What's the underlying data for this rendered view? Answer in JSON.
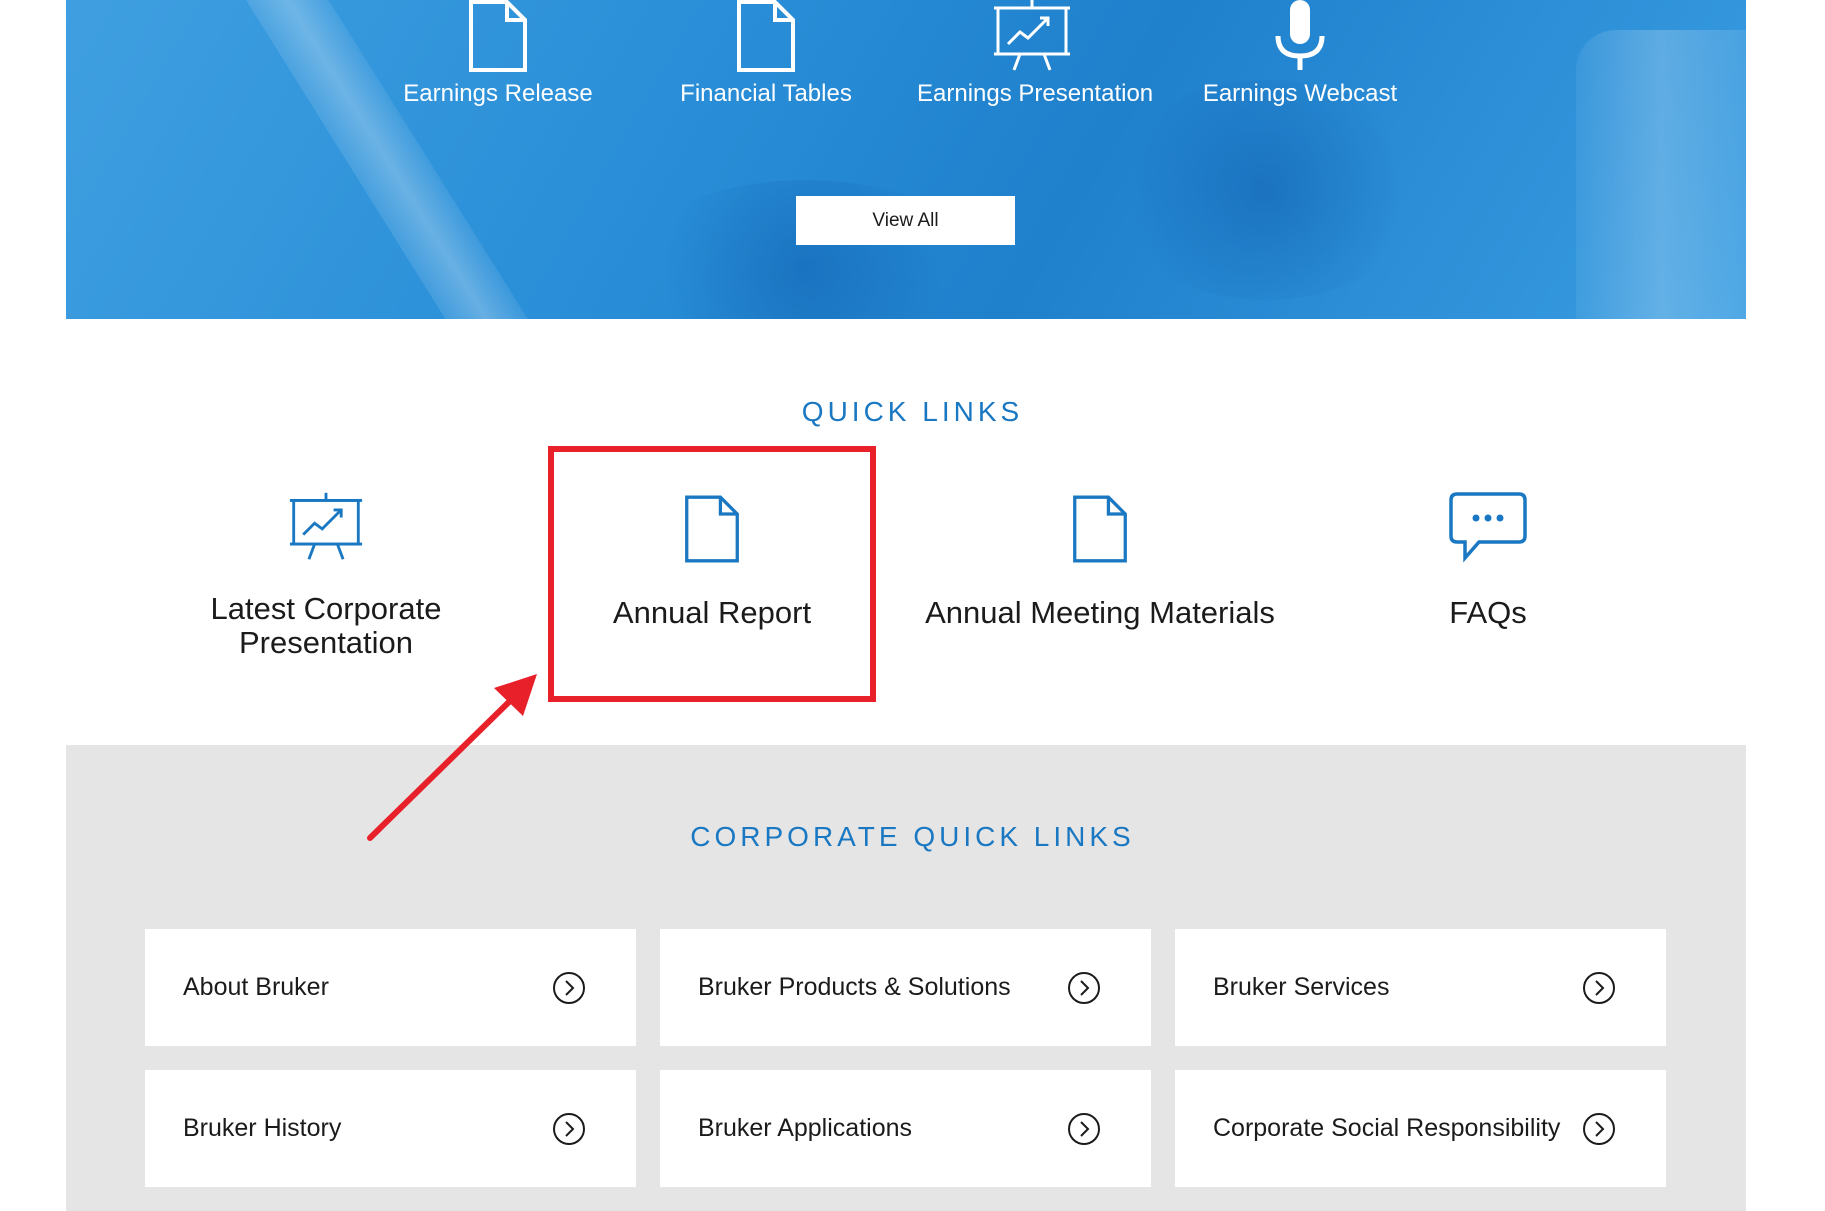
{
  "hero": {
    "items": [
      {
        "label": "Earnings Release",
        "icon": "document-icon"
      },
      {
        "label": "Financial Tables",
        "icon": "document-icon"
      },
      {
        "label": "Earnings Presentation",
        "icon": "presentation-board-icon"
      },
      {
        "label": "Earnings Webcast",
        "icon": "microphone-icon"
      }
    ],
    "view_all_label": "View All"
  },
  "quick_links": {
    "title": "QUICK LINKS",
    "items": [
      {
        "label": "Latest Corporate Presentation",
        "icon": "presentation-board-icon"
      },
      {
        "label": "Annual Report",
        "icon": "document-icon"
      },
      {
        "label": "Annual Meeting Materials",
        "icon": "document-icon"
      },
      {
        "label": "FAQs",
        "icon": "chat-bubble-icon"
      }
    ]
  },
  "corporate_quick_links": {
    "title": "CORPORATE QUICK LINKS",
    "items": [
      {
        "label": "About Bruker"
      },
      {
        "label": "Bruker Products & Solutions"
      },
      {
        "label": "Bruker Services"
      },
      {
        "label": "Bruker History"
      },
      {
        "label": "Bruker Applications"
      },
      {
        "label": "Corporate Social Responsibility"
      }
    ]
  },
  "colors": {
    "accent_blue": "#1a78c2",
    "hero_blue": "#2a8fd8",
    "annotation_red": "#e8202a",
    "panel_gray": "#e5e5e5"
  }
}
